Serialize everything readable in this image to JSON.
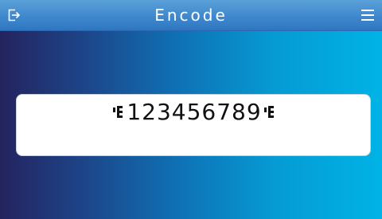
{
  "header": {
    "title": "Encode",
    "back_icon": "exit-icon",
    "menu_icon": "hamburger-menu-icon",
    "background_color": "#3f88cd"
  },
  "result": {
    "encoded_text": "123456789",
    "start_marker_icon": "control-marker-icon",
    "end_marker_icon": "control-marker-icon"
  },
  "colors": {
    "gradient_left": "#24235e",
    "gradient_right": "#00b3e6",
    "box_background": "#ffffff"
  }
}
